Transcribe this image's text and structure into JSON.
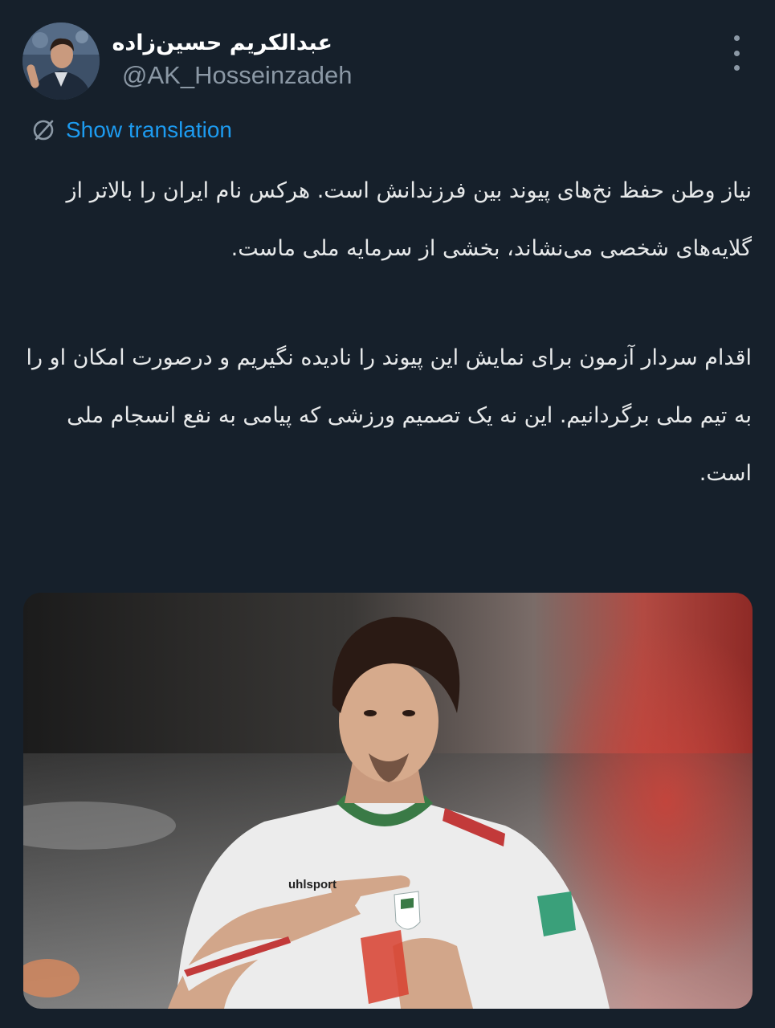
{
  "author": {
    "display_name": "عبدالکریم حسین‌زاده",
    "handle": "@AK_Hosseinzadeh"
  },
  "translation": {
    "label": "Show translation",
    "icon": "globe-translate-icon"
  },
  "menu": {
    "icon": "more-vertical-icon"
  },
  "tweet": {
    "paragraphs": [
      "نیاز وطن حفظ نخ‌های پیوند بین فرزندانش است. هرکس نام ایران را بالاتر از گلایه‌های شخصی می‌نشاند، بخشی از سرمایه ملی ماست.",
      "اقدام سردار آزمون برای نمایش این پیوند را نادیده نگیریم و درصورت امکان او را به تیم ملی برگردانیم. این نه یک تصمیم ورزشی که پیامی به نفع انسجام ملی است."
    ]
  },
  "media": {
    "jersey_brand": "uhlsport"
  },
  "colors": {
    "background": "#16202b",
    "text": "#e7e9ea",
    "secondary_text": "#8b98a5",
    "link": "#1d9bf0"
  }
}
